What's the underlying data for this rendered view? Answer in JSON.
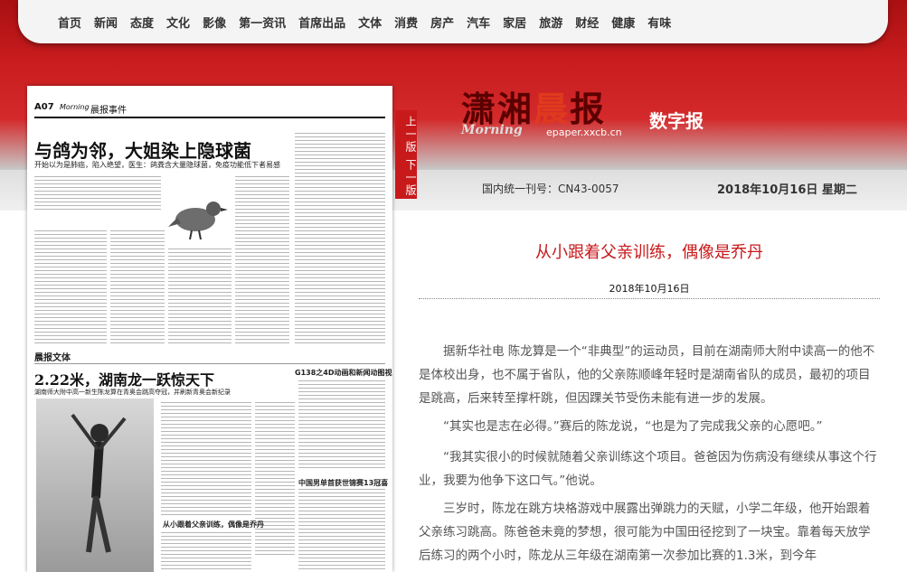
{
  "nav": [
    "首页",
    "新闻",
    "态度",
    "文化",
    "影像",
    "第一资讯",
    "首席出品",
    "文体",
    "消费",
    "房产",
    "汽车",
    "家居",
    "旅游",
    "财经",
    "健康",
    "有味"
  ],
  "paper": {
    "page_no": "A07",
    "brand": "Morning",
    "section": "晨报事件",
    "headline": "与鸽为邻，大姐染上隐球菌",
    "subline": "开始以为是肺癌，陷入绝望，医生：鸽粪含大量隐球菌，免疫功能低下者易感",
    "section2": "晨报文体",
    "headline2": "2.22米，湖南龙一跃惊天下",
    "subline2": "湖南师大附中高一新生陈龙算在青奥会跳高夺冠，并刷新青奥会新纪录",
    "caption_a": "从小跟着父亲训练，偶像是乔丹",
    "caption_b": "中国男单首获世锦赛13冠喜",
    "caption_c": "G138之4D动画和新闻动图视"
  },
  "tabs": {
    "up": "上一版",
    "down": "下一版"
  },
  "logo": {
    "part1": "潇湘",
    "part2": "晨",
    "part3": "报",
    "digital": "数字报",
    "morning": "Morning",
    "url": "epaper.xxcb.cn"
  },
  "issn": "国内统一刊号：CN43-0057",
  "date_top": "2018年10月16日 星期二",
  "article": {
    "title": "从小跟着父亲训练，偶像是乔丹",
    "date": "2018年10月16日",
    "paragraphs": [
      "据新华社电 陈龙算是一个“非典型”的运动员，目前在湖南师大附中读高一的他不是体校出身，也不属于省队，他的父亲陈顺峰年轻时是湖南省队的成员，最初的项目是跳高，后来转至撑杆跳，但因踝关节受伤未能有进一步的发展。",
      "“其实也是志在必得。”赛后的陈龙说，“也是为了完成我父亲的心愿吧。”",
      "“我其实很小的时候就随着父亲训练这个项目。爸爸因为伤病没有继续从事这个行业，我要为他争下这口气。”他说。",
      "三岁时，陈龙在跳方块格游戏中展露出弹跳力的天赋，小学二年级，他开始跟着父亲练习跳高。陈爸爸未竟的梦想，很可能为中国田径挖到了一块宝。靠着每天放学后练习的两个小时，陈龙从三年级在湖南第一次参加比赛的1.3米，到今年"
    ]
  }
}
